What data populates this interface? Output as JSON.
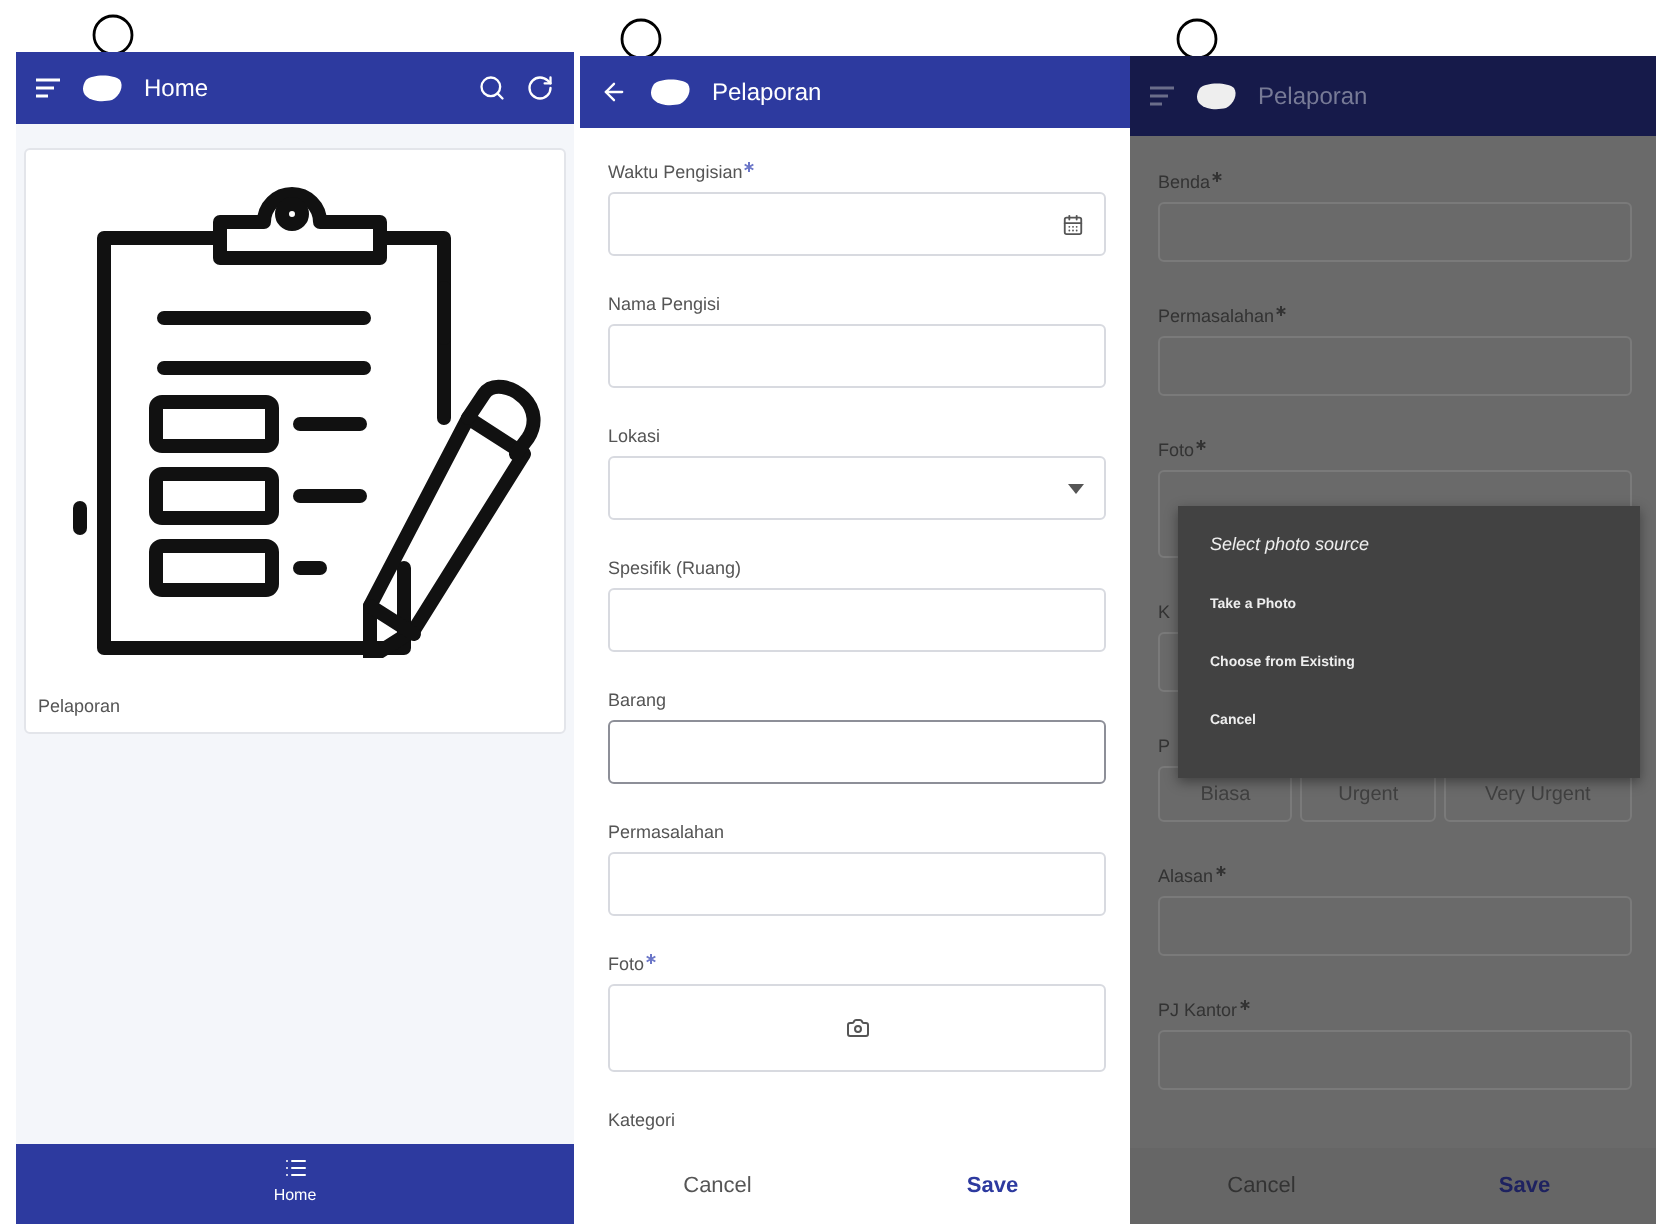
{
  "home_screen": {
    "header": {
      "title": "Home"
    },
    "card": {
      "caption": "Pelaporan"
    },
    "bottom_nav": [
      {
        "label": "Home",
        "selected": true
      }
    ]
  },
  "form_screen": {
    "header": {
      "title": "Pelaporan"
    },
    "fields": [
      {
        "label": "Waktu Pengisian",
        "required": true,
        "kind": "date",
        "focused": false
      },
      {
        "label": "Nama Pengisi",
        "required": false,
        "kind": "text",
        "focused": false
      },
      {
        "label": "Lokasi",
        "required": false,
        "kind": "select",
        "focused": false
      },
      {
        "label": "Spesifik (Ruang)",
        "required": false,
        "kind": "text",
        "focused": false
      },
      {
        "label": "Barang",
        "required": false,
        "kind": "text",
        "focused": true
      },
      {
        "label": "Permasalahan",
        "required": false,
        "kind": "text",
        "focused": false
      },
      {
        "label": "Foto",
        "required": true,
        "kind": "photo",
        "focused": false
      },
      {
        "label": "Kategori",
        "required": false,
        "kind": "label_only"
      }
    ],
    "actions": {
      "cancel": "Cancel",
      "save": "Save"
    }
  },
  "dialog_screen": {
    "header": {
      "title": "Pelaporan"
    },
    "fields": [
      {
        "label": "Benda",
        "required": true,
        "kind": "text"
      },
      {
        "label": "Permasalahan",
        "required": true,
        "kind": "text"
      },
      {
        "label": "Foto",
        "required": true,
        "kind": "photo"
      },
      {
        "label": "K",
        "required": false,
        "kind": "text"
      },
      {
        "label": "P",
        "required": false,
        "kind": "choices",
        "options": [
          {
            "label": "Biasa",
            "selected": false
          },
          {
            "label": "Urgent",
            "selected": false
          },
          {
            "label": "Very Urgent",
            "selected": false
          }
        ]
      },
      {
        "label": "Alasan",
        "required": true,
        "kind": "text"
      },
      {
        "label": "PJ Kantor",
        "required": true,
        "kind": "text"
      }
    ],
    "dialog": {
      "title": "Select photo source",
      "options": [
        "Take a Photo",
        "Choose from Existing",
        "Cancel"
      ]
    },
    "actions": {
      "cancel": "Cancel",
      "save": "Save"
    }
  }
}
